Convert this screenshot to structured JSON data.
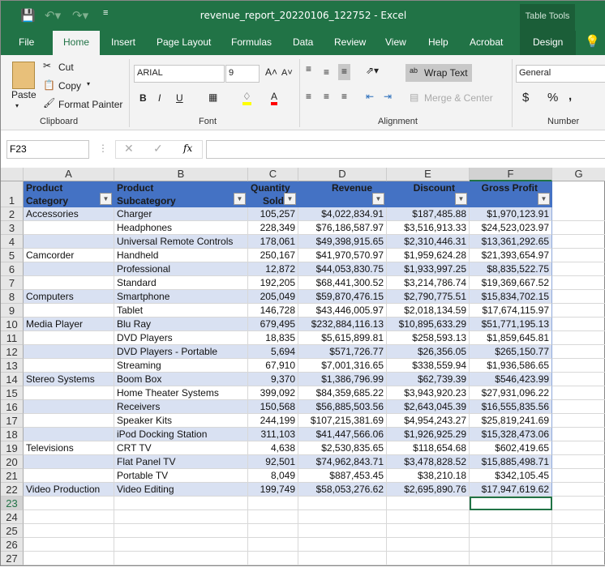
{
  "window": {
    "title": "revenue_report_20220106_122752  -  Excel",
    "context_tab": "Table Tools"
  },
  "tabs": [
    "File",
    "Home",
    "Insert",
    "Page Layout",
    "Formulas",
    "Data",
    "Review",
    "View",
    "Help",
    "Acrobat",
    "Design"
  ],
  "tell_me_icon": "lightbulb-icon",
  "clipboard": {
    "paste": "Paste",
    "cut": "Cut",
    "copy": "Copy",
    "format_painter": "Format Painter",
    "group": "Clipboard"
  },
  "font": {
    "name": "ARIAL",
    "size": "9",
    "bold": "B",
    "italic": "I",
    "underline": "U",
    "group": "Font",
    "fill_color": "#ffff00",
    "font_color": "#ff0000"
  },
  "alignment": {
    "wrap_text": "Wrap Text",
    "merge_center": "Merge & Center",
    "group": "Alignment"
  },
  "number": {
    "format": "General",
    "currency": "$",
    "percent": "%",
    "comma": ",",
    "group": "Number"
  },
  "formula_bar": {
    "name_box": "F23",
    "fx": "fx",
    "value": ""
  },
  "columns": [
    "A",
    "B",
    "C",
    "D",
    "E",
    "F",
    "G"
  ],
  "table_headers": [
    [
      "Product",
      "Category"
    ],
    [
      "Product",
      "Subcategory"
    ],
    [
      "Quantity",
      "Sold"
    ],
    [
      "",
      "Revenue"
    ],
    [
      "",
      "Discount"
    ],
    [
      "",
      "Gross Profit"
    ]
  ],
  "rows": [
    [
      "Accessories",
      "Charger",
      "105,257",
      "$4,022,834.91",
      "$187,485.88",
      "$1,970,123.91"
    ],
    [
      "",
      "Headphones",
      "228,349",
      "$76,186,587.97",
      "$3,516,913.33",
      "$24,523,023.97"
    ],
    [
      "",
      "Universal Remote Controls",
      "178,061",
      "$49,398,915.65",
      "$2,310,446.31",
      "$13,361,292.65"
    ],
    [
      "Camcorder",
      "Handheld",
      "250,167",
      "$41,970,570.97",
      "$1,959,624.28",
      "$21,393,654.97"
    ],
    [
      "",
      "Professional",
      "12,872",
      "$44,053,830.75",
      "$1,933,997.25",
      "$8,835,522.75"
    ],
    [
      "",
      "Standard",
      "192,205",
      "$68,441,300.52",
      "$3,214,786.74",
      "$19,369,667.52"
    ],
    [
      "Computers",
      "Smartphone",
      "205,049",
      "$59,870,476.15",
      "$2,790,775.51",
      "$15,834,702.15"
    ],
    [
      "",
      "Tablet",
      "146,728",
      "$43,446,005.97",
      "$2,018,134.59",
      "$17,674,115.97"
    ],
    [
      "Media Player",
      "Blu Ray",
      "679,495",
      "$232,884,116.13",
      "$10,895,633.29",
      "$51,771,195.13"
    ],
    [
      "",
      "DVD Players",
      "18,835",
      "$5,615,899.81",
      "$258,593.13",
      "$1,859,645.81"
    ],
    [
      "",
      "DVD Players - Portable",
      "5,694",
      "$571,726.77",
      "$26,356.05",
      "$265,150.77"
    ],
    [
      "",
      "Streaming",
      "67,910",
      "$7,001,316.65",
      "$338,559.94",
      "$1,936,586.65"
    ],
    [
      "Stereo Systems",
      "Boom Box",
      "9,370",
      "$1,386,796.99",
      "$62,739.39",
      "$546,423.99"
    ],
    [
      "",
      "Home Theater Systems",
      "399,092",
      "$84,359,685.22",
      "$3,943,920.23",
      "$27,931,096.22"
    ],
    [
      "",
      "Receivers",
      "150,568",
      "$56,885,503.56",
      "$2,643,045.39",
      "$16,555,835.56"
    ],
    [
      "",
      "Speaker Kits",
      "244,199",
      "$107,215,381.69",
      "$4,954,243.27",
      "$25,819,241.69"
    ],
    [
      "",
      "iPod Docking Station",
      "311,103",
      "$41,447,566.06",
      "$1,926,925.29",
      "$15,328,473.06"
    ],
    [
      "Televisions",
      "CRT TV",
      "4,638",
      "$2,530,835.65",
      "$118,654.68",
      "$602,419.65"
    ],
    [
      "",
      "Flat Panel TV",
      "92,501",
      "$74,962,843.71",
      "$3,478,828.52",
      "$15,885,498.71"
    ],
    [
      "",
      "Portable TV",
      "8,049",
      "$887,453.45",
      "$38,210.18",
      "$342,105.45"
    ],
    [
      "Video Production",
      "Video Editing",
      "199,749",
      "$58,053,276.62",
      "$2,695,890.76",
      "$17,947,619.62"
    ]
  ],
  "row_numbers": [
    "1",
    "2",
    "3",
    "4",
    "5",
    "6",
    "7",
    "8",
    "9",
    "10",
    "11",
    "12",
    "13",
    "14",
    "15",
    "16",
    "17",
    "18",
    "19",
    "20",
    "21",
    "22",
    "23",
    "24",
    "25",
    "26",
    "27"
  ],
  "colors": {
    "ribbon_green": "#217346",
    "table_header": "#4472c4",
    "band": "#d9e1f2"
  }
}
